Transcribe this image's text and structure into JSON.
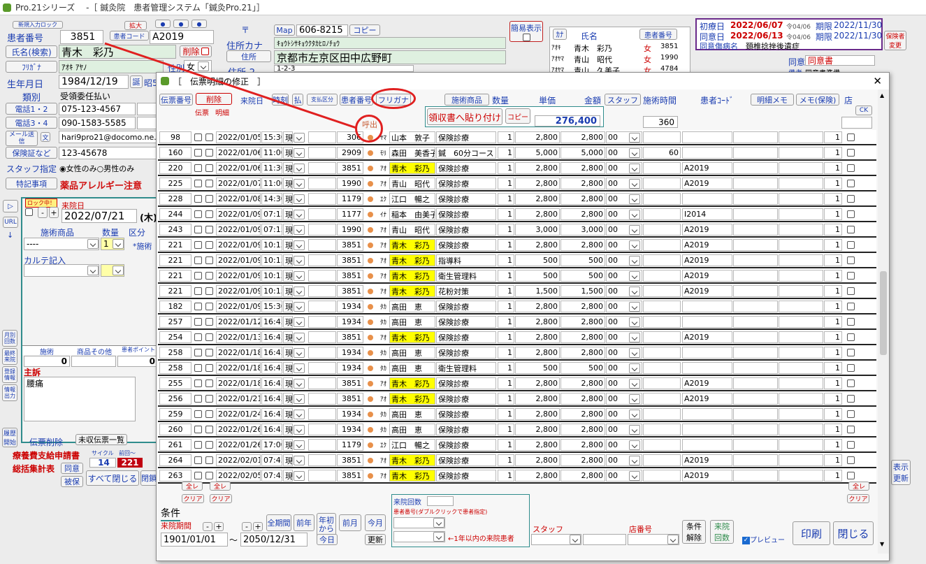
{
  "app": {
    "title": "Pro.21シリーズ　 -［ 鍼灸院　患者管理システム「鍼灸Pro.21」］"
  },
  "main": {
    "patient_no_label": "患者番号",
    "patient_no": "3851",
    "hold_label": "新規入力ロック",
    "expand": "拡大",
    "patient_code_label": "患者コード",
    "patient_code": "A2019",
    "name_btn": "氏名(検索)",
    "name": "青木　彩乃",
    "delete_label": "削除",
    "kana_btn": "ﾌﾘｶﾞﾅ",
    "kana": "ｱｵｷ ｱﾔﾉ",
    "sex_label": "性別",
    "sex": "女",
    "birth_label": "生年月日",
    "birth": "1984/12/19",
    "birth_tag": "誕",
    "birth_era": "昭5",
    "type_label": "類別",
    "type": "受領委任払い",
    "tel12": "電話1・2",
    "tel1": "075-123-4567",
    "tel34": "電話3・4",
    "tel3": "090-1583-5585",
    "mail_btn": "メール送信",
    "mail_icon": "文",
    "mail": "hari9pro21@docomo.ne.",
    "insurance_btn": "保険証など",
    "insurance": "123-45678",
    "staff_label": "スタッフ指定",
    "staff_opt1": "女性のみ",
    "staff_opt2": "男性のみ",
    "notes_btn": "特記事項",
    "notes": "薬品アレルギー注意",
    "post_sym": "〒",
    "addr_kana_label": "住所カナ",
    "map": "Map",
    "postcode": "606-8215",
    "copy": "コピー",
    "addr_kana": "ｷｮｳﾄｼｻｷｮｳｸﾀｶﾋﾛﾉﾁｮｳ",
    "addr_label": "住所",
    "addr": "京都市左京区田中広野町",
    "addr2_label": "住所-2",
    "addr2": "1-2-3",
    "simple_label": "簡易表示",
    "kana_tag": "ｶﾅ",
    "name_col": "氏名",
    "patno_col": "患者番号",
    "mini_list": [
      {
        "k": "ｱｵｷ",
        "n": "青木　彩乃",
        "s": "女",
        "no": "3851"
      },
      {
        "k": "ｱｵﾔﾏ",
        "n": "青山　昭代",
        "s": "女",
        "no": "1990"
      },
      {
        "k": "ｱｵﾔﾏ",
        "n": "青山　久美子",
        "s": "女",
        "no": "4784"
      }
    ],
    "first_visit_label": "初療日",
    "first_visit": "2022/06/07",
    "fv_era": "令04/06",
    "term_label": "期限",
    "term1": "2022/11/30",
    "consent_label": "同意日",
    "consent": "2022/06/13",
    "cn_era": "令04/06",
    "term2": "2022/11/30",
    "consent_dis_label": "同意傷病名",
    "consent_dis": "頚椎捻挫後遺症",
    "insurer_btn": "保険者変更",
    "consent_doc_label": "同意",
    "consent_doc": "同意書",
    "prep_label": "備考",
    "prep_val": "同意書準備"
  },
  "left": {
    "lock": "ロック中！",
    "visit_label": "来院日",
    "visit_date": "2022/07/21",
    "visit_day": "(木)",
    "menu_col": "施術商品",
    "qty_col": "数量",
    "cat_col": "区分",
    "menu_val": "----",
    "qty_val": "1",
    "cat_val": "*施術",
    "chart_label": "カルテ記入",
    "side_labels": [
      "月別回数",
      "最終来院",
      "登録情報",
      "情報出力"
    ],
    "url": "URL",
    "stat_cols": [
      "施術",
      "商品その他",
      "患者ポイント"
    ],
    "stat_val1": "0",
    "stat_val2": "0",
    "complaint_label": "主訴",
    "complaint": "腰痛",
    "slip_delete": "伝票削除",
    "unpaid": "未収伝票一覧",
    "history_btn": "履歴開始",
    "cycle_label": "サイクル",
    "prev_label": "前回～",
    "cycle1": "14",
    "cycle2": "221",
    "subsidy": "療養費支給申請書",
    "total": "総括集計表",
    "agree": "同意",
    "insured": "被保",
    "close_all": "すべて閉じる",
    "close_part": "閉鎖",
    "display": "表示",
    "refresh": "更新"
  },
  "modal": {
    "title": "［　伝票明細の修正　］",
    "hdr": {
      "slip_no": "伝票番号",
      "delete": "削除",
      "visit": "来院日",
      "time": "時刻",
      "pay": "払",
      "pay_cat": "支払区分",
      "pat_no": "患者番号",
      "kana": "フリガナ",
      "menu": "施術商品",
      "qty": "数量",
      "price": "単価",
      "amount": "金額",
      "staff": "スタッフ",
      "proc_time": "施術時間",
      "pat_code": "患者ｺｰﾄﾞ",
      "memo": "明細メモ",
      "memo_ins": "メモ(保険)",
      "store": "店",
      "slip": "伝票",
      "detail": "明細",
      "ck": "CK",
      "receipt": "領収書へ貼り付け",
      "copy": "コピー",
      "total": "276,400",
      "time_total": "360",
      "call": "呼出"
    },
    "rows": [
      {
        "slip": "98",
        "date": "2022/01/05",
        "time": "15:30",
        "pay": "現",
        "pno": "306",
        "k": "ﾔﾏ",
        "name": "山本　敦子",
        "menu": "保険診療",
        "qty": "1",
        "price": "2,800",
        "amt": "2,800",
        "staff": "00",
        "ptime": "",
        "code": "",
        "store": "1",
        "hl": false
      },
      {
        "slip": "160",
        "date": "2022/01/06",
        "time": "11:00",
        "pay": "現",
        "pno": "2909",
        "k": "ﾓﾘ",
        "name": "森田　美香子",
        "menu": "鍼　60分コース",
        "qty": "1",
        "price": "5,000",
        "amt": "5,000",
        "staff": "00",
        "ptime": "60",
        "code": "",
        "store": "1",
        "hl": false
      },
      {
        "slip": "220",
        "date": "2022/01/06",
        "time": "11:30",
        "pay": "現",
        "pno": "3851",
        "k": "ｱｵ",
        "name": "青木　彩乃",
        "menu": "保険診療",
        "qty": "1",
        "price": "2,800",
        "amt": "2,800",
        "staff": "00",
        "ptime": "",
        "code": "A2019",
        "store": "1",
        "hl": true
      },
      {
        "slip": "225",
        "date": "2022/01/07",
        "time": "11:00",
        "pay": "現",
        "pno": "1990",
        "k": "ｱｵ",
        "name": "青山　昭代",
        "menu": "保険診療",
        "qty": "1",
        "price": "2,800",
        "amt": "2,800",
        "staff": "00",
        "ptime": "",
        "code": "A2019",
        "store": "1",
        "hl": false
      },
      {
        "slip": "228",
        "date": "2022/01/08",
        "time": "14:30",
        "pay": "現",
        "pno": "1179",
        "k": "ｴｸ",
        "name": "江口　暢之",
        "menu": "保険診療",
        "qty": "1",
        "price": "2,800",
        "amt": "2,800",
        "staff": "00",
        "ptime": "",
        "code": "",
        "store": "1",
        "hl": false
      },
      {
        "slip": "244",
        "date": "2022/01/09",
        "time": "07:15",
        "pay": "現",
        "pno": "1177",
        "k": "ｲﾅ",
        "name": "稲本　由美子",
        "menu": "保険診療",
        "qty": "1",
        "price": "2,800",
        "amt": "2,800",
        "staff": "00",
        "ptime": "",
        "code": "I2014",
        "store": "1",
        "hl": false
      },
      {
        "slip": "243",
        "date": "2022/01/09",
        "time": "07:15",
        "pay": "現",
        "pno": "1990",
        "k": "ｱｵ",
        "name": "青山　昭代",
        "menu": "保険診療",
        "qty": "1",
        "price": "3,000",
        "amt": "3,000",
        "staff": "00",
        "ptime": "",
        "code": "A2019",
        "store": "1",
        "hl": false
      },
      {
        "slip": "221",
        "date": "2022/01/09",
        "time": "10:15",
        "pay": "現",
        "pno": "3851",
        "k": "ｱｵ",
        "name": "青木　彩乃",
        "menu": "保険診療",
        "qty": "1",
        "price": "2,800",
        "amt": "2,800",
        "staff": "00",
        "ptime": "",
        "code": "A2019",
        "store": "1",
        "hl": true
      },
      {
        "slip": "221",
        "date": "2022/01/09",
        "time": "10:15",
        "pay": "現",
        "pno": "3851",
        "k": "ｱｵ",
        "name": "青木　彩乃",
        "menu": "指導料",
        "qty": "1",
        "price": "500",
        "amt": "500",
        "staff": "00",
        "ptime": "",
        "code": "A2019",
        "store": "1",
        "hl": true
      },
      {
        "slip": "221",
        "date": "2022/01/09",
        "time": "10:15",
        "pay": "現",
        "pno": "3851",
        "k": "ｱｵ",
        "name": "青木　彩乃",
        "menu": "衛生管理料",
        "qty": "1",
        "price": "500",
        "amt": "500",
        "staff": "00",
        "ptime": "",
        "code": "A2019",
        "store": "1",
        "hl": true
      },
      {
        "slip": "221",
        "date": "2022/01/09",
        "time": "10:15",
        "pay": "現",
        "pno": "3851",
        "k": "ｱｵ",
        "name": "青木　彩乃",
        "menu": "花粉対策",
        "qty": "1",
        "price": "1,500",
        "amt": "1,500",
        "staff": "00",
        "ptime": "",
        "code": "A2019",
        "store": "1",
        "hl": true
      },
      {
        "slip": "182",
        "date": "2022/01/09",
        "time": "15:30",
        "pay": "現",
        "pno": "1934",
        "k": "ﾀｶ",
        "name": "高田　恵",
        "menu": "保険診療",
        "qty": "1",
        "price": "2,800",
        "amt": "2,800",
        "staff": "00",
        "ptime": "",
        "code": "",
        "store": "1",
        "hl": false
      },
      {
        "slip": "257",
        "date": "2022/01/12",
        "time": "16:45",
        "pay": "現",
        "pno": "1934",
        "k": "ﾀｶ",
        "name": "高田　恵",
        "menu": "保険診療",
        "qty": "1",
        "price": "2,800",
        "amt": "2,800",
        "staff": "00",
        "ptime": "",
        "code": "",
        "store": "1",
        "hl": false
      },
      {
        "slip": "254",
        "date": "2022/01/13",
        "time": "16:45",
        "pay": "現",
        "pno": "3851",
        "k": "ｱｵ",
        "name": "青木　彩乃",
        "menu": "保険診療",
        "qty": "1",
        "price": "2,800",
        "amt": "2,800",
        "staff": "00",
        "ptime": "",
        "code": "A2019",
        "store": "1",
        "hl": true
      },
      {
        "slip": "258",
        "date": "2022/01/18",
        "time": "16:45",
        "pay": "現",
        "pno": "1934",
        "k": "ﾀｶ",
        "name": "高田　恵",
        "menu": "保険診療",
        "qty": "1",
        "price": "2,800",
        "amt": "2,800",
        "staff": "00",
        "ptime": "",
        "code": "",
        "store": "1",
        "hl": false
      },
      {
        "slip": "258",
        "date": "2022/01/18",
        "time": "16:45",
        "pay": "現",
        "pno": "1934",
        "k": "ﾀｶ",
        "name": "高田　恵",
        "menu": "衛生管理料",
        "qty": "1",
        "price": "500",
        "amt": "500",
        "staff": "00",
        "ptime": "",
        "code": "",
        "store": "1",
        "hl": false
      },
      {
        "slip": "255",
        "date": "2022/01/18",
        "time": "16:45",
        "pay": "現",
        "pno": "3851",
        "k": "ｱｵ",
        "name": "青木　彩乃",
        "menu": "保険診療",
        "qty": "1",
        "price": "2,800",
        "amt": "2,800",
        "staff": "00",
        "ptime": "",
        "code": "A2019",
        "store": "1",
        "hl": true
      },
      {
        "slip": "256",
        "date": "2022/01/21",
        "time": "16:45",
        "pay": "現",
        "pno": "3851",
        "k": "ｱｵ",
        "name": "青木　彩乃",
        "menu": "保険診療",
        "qty": "1",
        "price": "2,800",
        "amt": "2,800",
        "staff": "00",
        "ptime": "",
        "code": "A2019",
        "store": "1",
        "hl": true
      },
      {
        "slip": "259",
        "date": "2022/01/24",
        "time": "16:45",
        "pay": "現",
        "pno": "1934",
        "k": "ﾀｶ",
        "name": "高田　恵",
        "menu": "保険診療",
        "qty": "1",
        "price": "2,800",
        "amt": "2,800",
        "staff": "00",
        "ptime": "",
        "code": "",
        "store": "1",
        "hl": false
      },
      {
        "slip": "260",
        "date": "2022/01/26",
        "time": "16:45",
        "pay": "現",
        "pno": "1934",
        "k": "ﾀｶ",
        "name": "高田　恵",
        "menu": "保険診療",
        "qty": "1",
        "price": "2,800",
        "amt": "2,800",
        "staff": "00",
        "ptime": "",
        "code": "",
        "store": "1",
        "hl": false
      },
      {
        "slip": "261",
        "date": "2022/01/26",
        "time": "17:00",
        "pay": "現",
        "pno": "1179",
        "k": "ｴｸ",
        "name": "江口　暢之",
        "menu": "保険診療",
        "qty": "1",
        "price": "2,800",
        "amt": "2,800",
        "staff": "00",
        "ptime": "",
        "code": "",
        "store": "1",
        "hl": false
      },
      {
        "slip": "264",
        "date": "2022/02/01",
        "time": "07:45",
        "pay": "現",
        "pno": "3851",
        "k": "ｱｵ",
        "name": "青木　彩乃",
        "menu": "保険診療",
        "qty": "1",
        "price": "2,800",
        "amt": "2,800",
        "staff": "00",
        "ptime": "",
        "code": "A2019",
        "store": "1",
        "hl": true
      },
      {
        "slip": "263",
        "date": "2022/02/05",
        "time": "07:45",
        "pay": "現",
        "pno": "3851",
        "k": "ｱｵ",
        "name": "青木　彩乃",
        "menu": "保険診療",
        "qty": "1",
        "price": "2,800",
        "amt": "2,800",
        "staff": "00",
        "ptime": "",
        "code": "A2019",
        "store": "1",
        "hl": true
      }
    ],
    "footer": {
      "all_l": "全レ",
      "clear_l": "クリア",
      "all_l2": "全レ",
      "clear_l2": "クリア",
      "cond": "条件",
      "period": "来院期間",
      "from": "1901/01/01",
      "tilde": "～",
      "to": "2050/12/31",
      "all_period": "全期間",
      "prev_year": "前年",
      "ytd": "年初から",
      "prev_month": "前月",
      "this_month": "今月",
      "today": "今日",
      "update": "更新",
      "visit_count": "来院回数",
      "pno_hint": "患者番号(ダブルクリックで患者指定)",
      "recent_hint": "←1年以内の来院患者",
      "staff": "スタッフ",
      "store": "店番号",
      "cond_clear": "条件解除",
      "visit_cnt_btn": "来院回数",
      "preview": "プレビュー",
      "print": "印刷",
      "close": "閉じる",
      "all_r": "全レ",
      "clear_r": "クリア"
    }
  }
}
